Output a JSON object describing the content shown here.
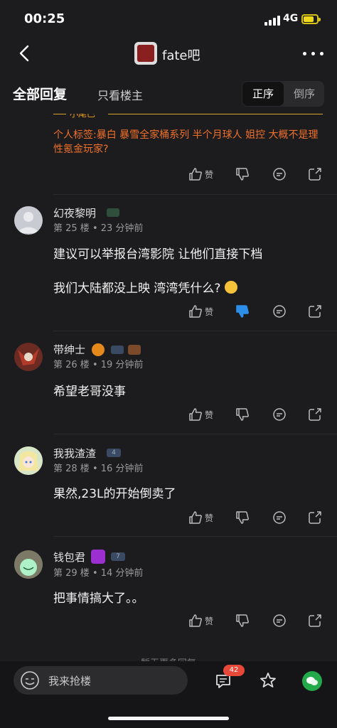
{
  "status_bar": {
    "time": "00:25",
    "network": "4G"
  },
  "nav": {
    "forum_name": "fate吧"
  },
  "tabs": {
    "all_replies": "全部回复",
    "owner_only": "只看楼主",
    "sort_asc": "正序",
    "sort_desc": "倒序"
  },
  "previous_post": {
    "tail_label": "小尾巴",
    "personal_tag": "个人标签:暴白 暴雪全家桶系列 半个月球人 姐控 大概不是理性氪金玩家?",
    "like_label": "赞"
  },
  "comments": [
    {
      "user": "幻夜黎明",
      "floor": "第 25 楼",
      "time": "23 分钟前",
      "lines": [
        "建议可以举报台湾影院 让他们直接下档",
        "我们大陆都没上映 湾湾凭什么?"
      ],
      "like_label": "赞",
      "level_badge": ""
    },
    {
      "user": "带绅士",
      "floor": "第 26 楼",
      "time": "19 分钟前",
      "lines": [
        "希望老哥没事"
      ],
      "like_label": "赞",
      "level_badge": ""
    },
    {
      "user": "我我渣渣",
      "floor": "第 28 楼",
      "time": "16 分钟前",
      "lines": [
        "果然,23L的开始倒卖了"
      ],
      "like_label": "赞",
      "level_badge": "4"
    },
    {
      "user": "钱包君",
      "floor": "第 29 楼",
      "time": "14 分钟前",
      "lines": [
        "把事情搞大了。。"
      ],
      "like_label": "赞",
      "level_badge": "7"
    }
  ],
  "footer_note": "暂无更多回复",
  "bottom_bar": {
    "reply_placeholder": "我来抢楼",
    "comment_count": "42"
  },
  "colors": {
    "background": "#1c1c1e",
    "accent_orange": "#f0702a",
    "like_blue": "#2d8ee8",
    "badge_red": "#e8483a",
    "wechat_green": "#23a84a"
  },
  "icons": [
    "back-icon",
    "more-icon",
    "like-icon",
    "dislike-icon",
    "comment-icon",
    "share-icon",
    "emoji-icon",
    "star-icon",
    "wechat-icon"
  ]
}
